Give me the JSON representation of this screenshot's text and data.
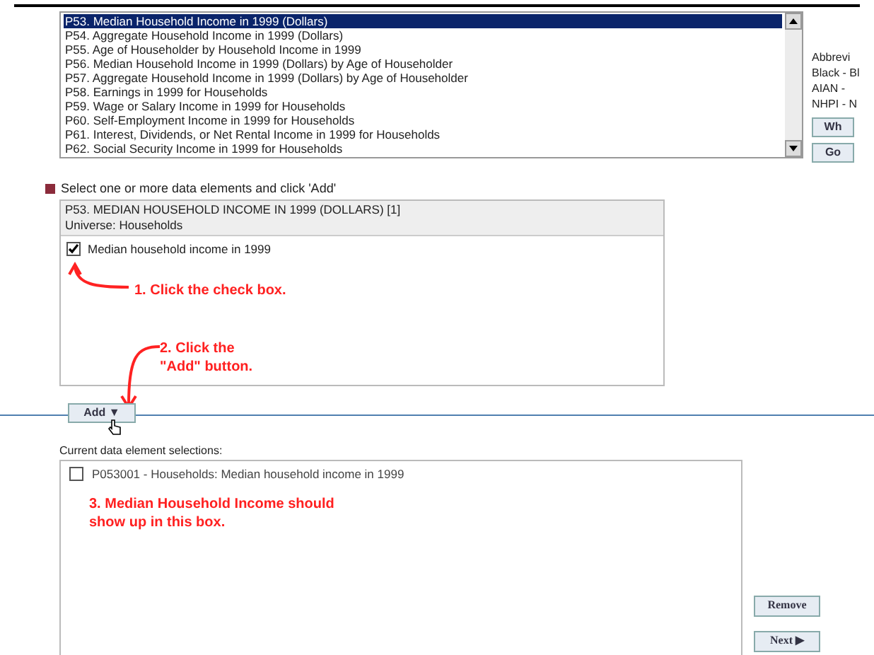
{
  "table_list": {
    "items": [
      {
        "label": "P53. Median Household Income in 1999 (Dollars)",
        "selected": true
      },
      {
        "label": "P54. Aggregate Household Income in 1999 (Dollars)",
        "selected": false
      },
      {
        "label": "P55. Age of Householder by Household Income in 1999",
        "selected": false
      },
      {
        "label": "P56. Median Household Income in 1999 (Dollars) by Age of Householder",
        "selected": false
      },
      {
        "label": "P57. Aggregate Household Income in 1999 (Dollars) by Age of Householder",
        "selected": false
      },
      {
        "label": "P58. Earnings in 1999 for Households",
        "selected": false
      },
      {
        "label": "P59. Wage or Salary Income in 1999 for Households",
        "selected": false
      },
      {
        "label": "P60. Self-Employment Income in 1999 for Households",
        "selected": false
      },
      {
        "label": "P61. Interest, Dividends, or Net Rental Income in 1999 for Households",
        "selected": false
      },
      {
        "label": "P62. Social Security Income in 1999 for Households",
        "selected": false
      }
    ]
  },
  "side_panel": {
    "lines": [
      "Abbrevi",
      "Black - Bl",
      "AIAN -",
      "NHPI - N"
    ],
    "buttons": [
      "Wh",
      "Go"
    ]
  },
  "elements": {
    "instruction": "Select one or more data elements and click 'Add'",
    "table_title": "P53. MEDIAN HOUSEHOLD INCOME IN 1999 (DOLLARS) [1]",
    "universe": "Universe: Households",
    "items": [
      {
        "label": "Median household income in 1999",
        "checked": true
      }
    ],
    "callout_1": "1. Click the check box.",
    "callout_2": "2. Click the \"Add\" button.",
    "add_button": "Add ▼"
  },
  "selections": {
    "label": "Current data element selections:",
    "items": [
      {
        "label": "P053001 - Households: Median household income in 1999",
        "checked": false
      }
    ],
    "callout_3": "3. Median Household Income should show up in this box."
  },
  "buttons": {
    "remove": "Remove",
    "next": "Next ▶"
  }
}
